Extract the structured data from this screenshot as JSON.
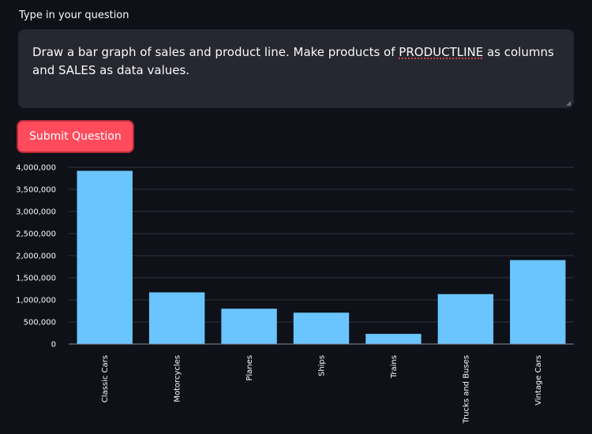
{
  "form": {
    "label": "Type in your question",
    "question_parts": [
      "Draw a bar graph of sales and product line. Make products of ",
      "PRODUCTLINE",
      " as columns and SALES as data values."
    ],
    "submit_label": "Submit Question"
  },
  "colors": {
    "background": "#0e1117",
    "input_bg": "#262730",
    "button_bg": "#ff4b5c",
    "bar": "#6ac5fe",
    "grid": "#31333f"
  },
  "chart_data": {
    "type": "bar",
    "categories": [
      "Classic Cars",
      "Motorcycles",
      "Planes",
      "Ships",
      "Trains",
      "Trucks and Buses",
      "Vintage Cars"
    ],
    "values": [
      3920000,
      1170000,
      800000,
      710000,
      230000,
      1130000,
      1900000
    ],
    "yticks": [
      "0",
      "500,000",
      "1,000,000",
      "1,500,000",
      "2,000,000",
      "2,500,000",
      "3,000,000",
      "3,500,000",
      "4,000,000"
    ],
    "ytick_values": [
      0,
      500000,
      1000000,
      1500000,
      2000000,
      2500000,
      3000000,
      3500000,
      4000000
    ],
    "ylim": [
      0,
      4000000
    ],
    "grid": true
  }
}
